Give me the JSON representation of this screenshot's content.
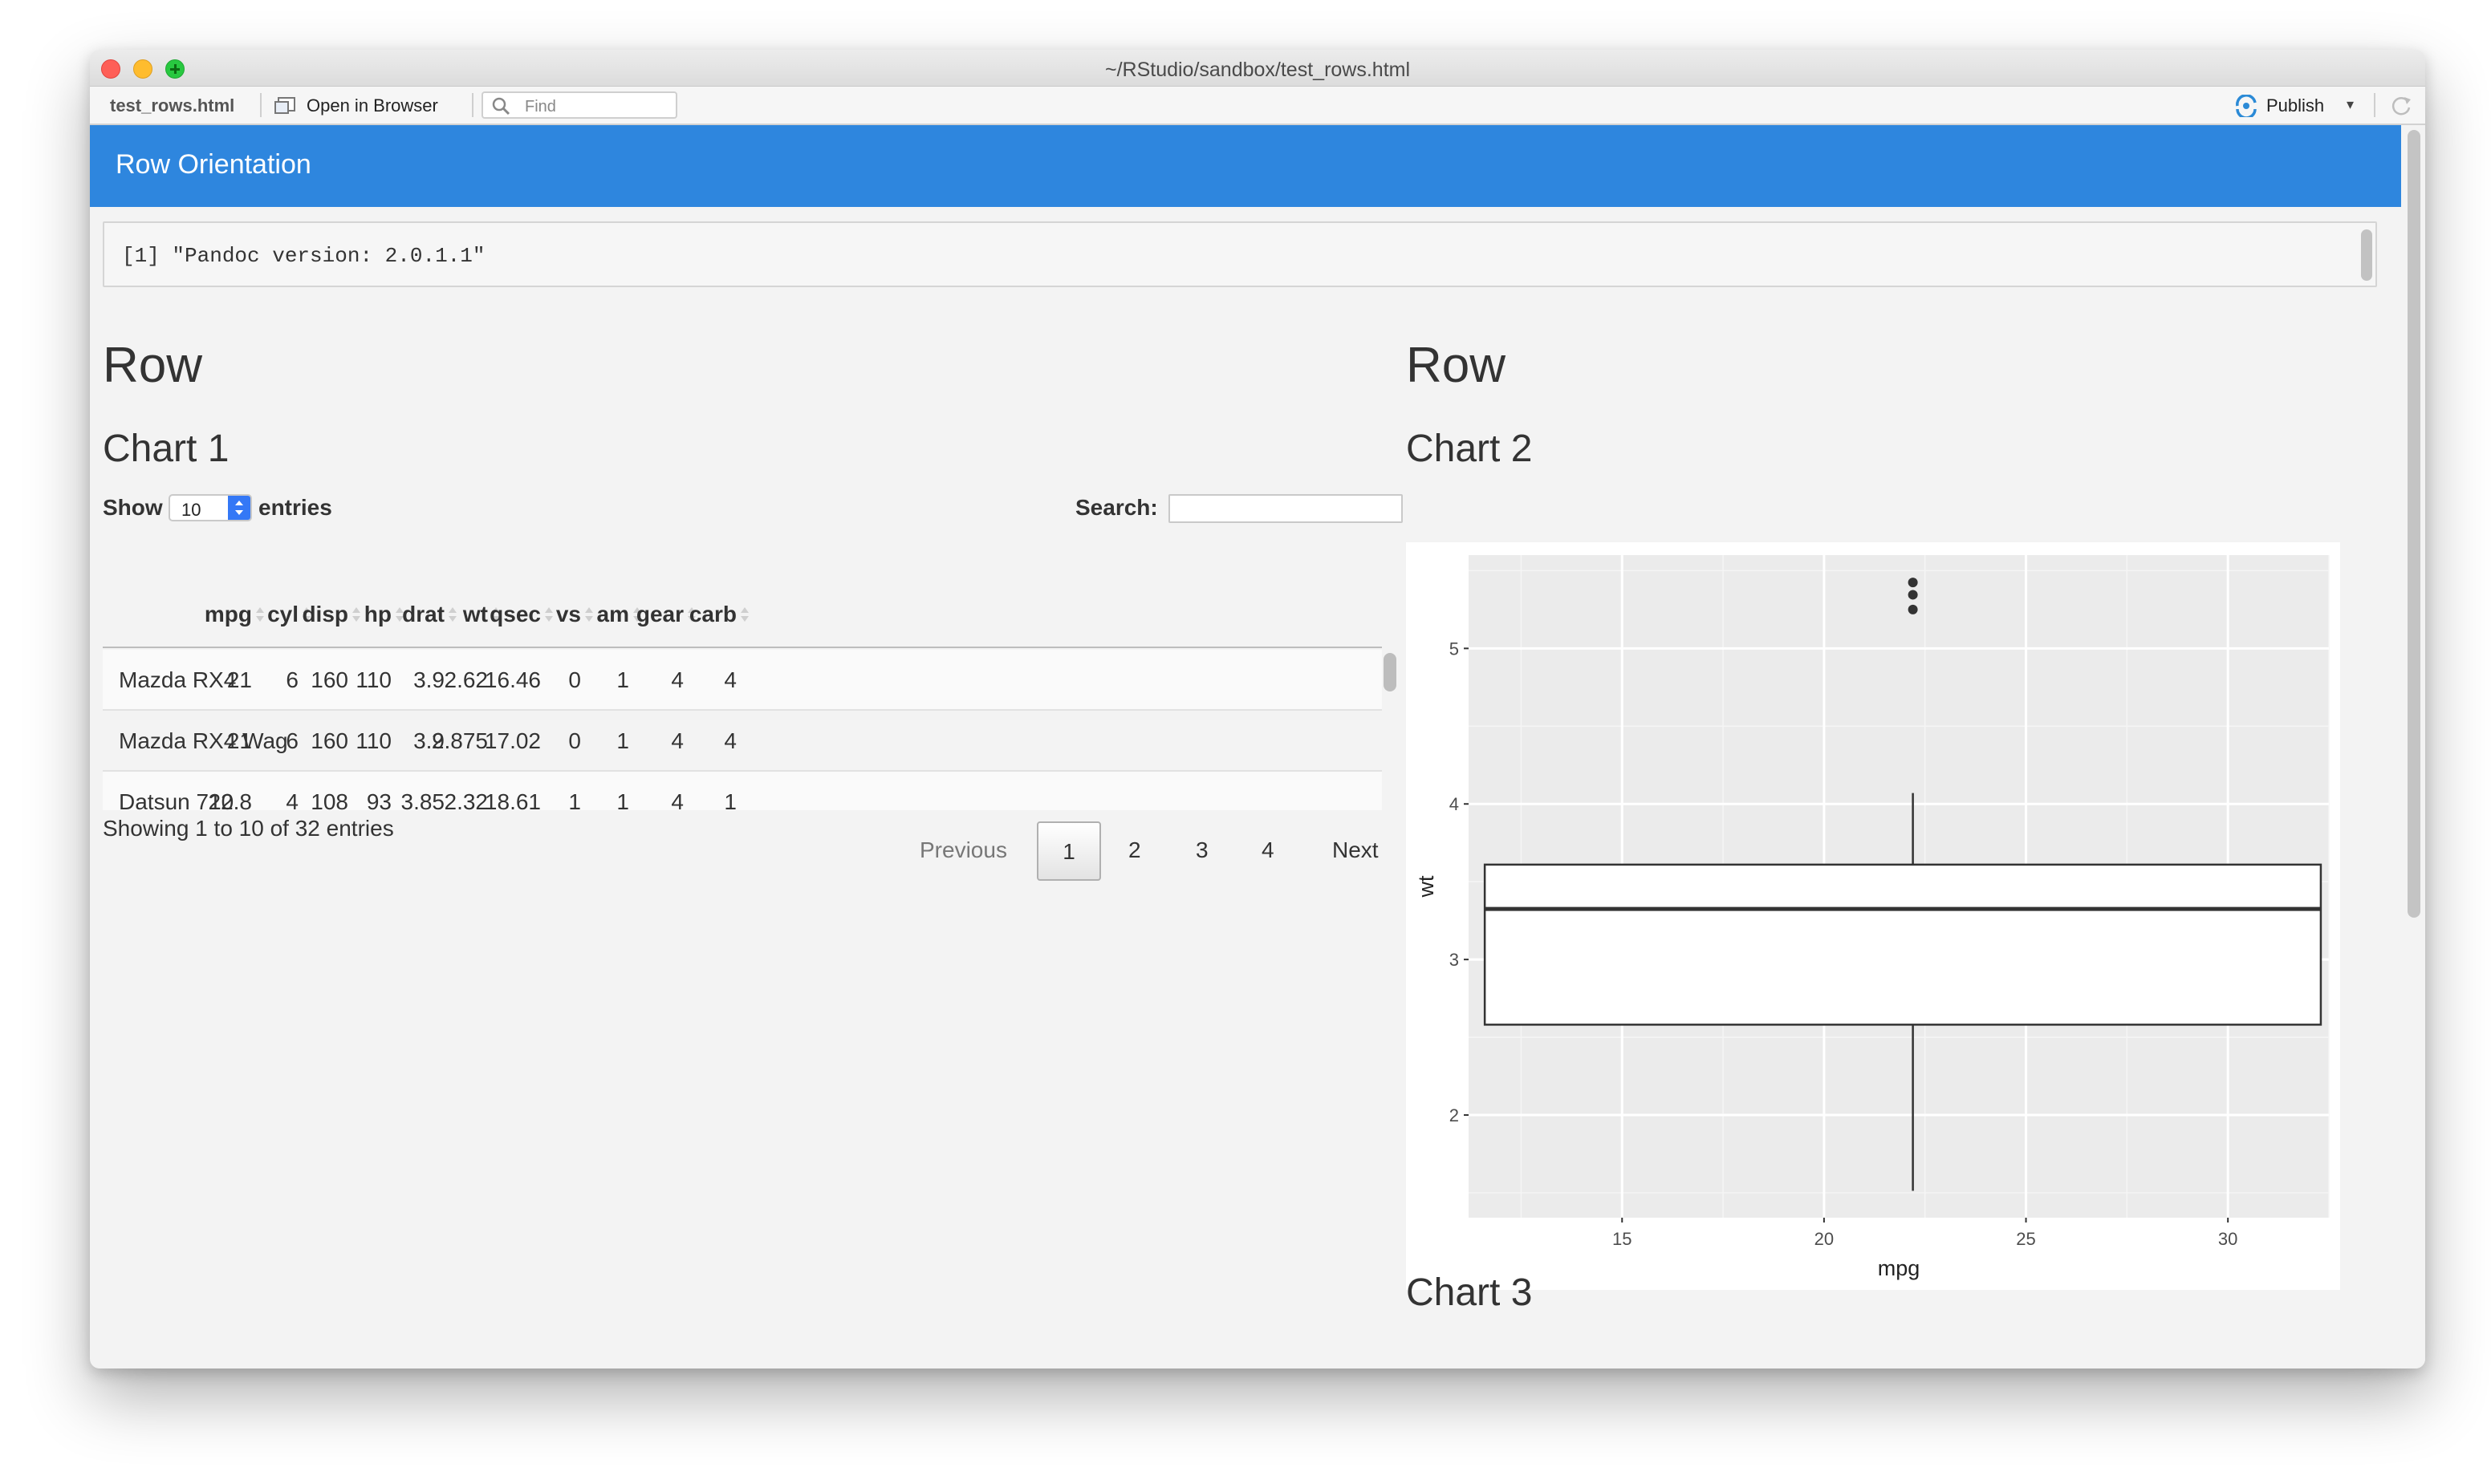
{
  "window": {
    "title": "~/RStudio/sandbox/test_rows.html"
  },
  "toolbar": {
    "file_name": "test_rows.html",
    "open_in_browser": "Open in Browser",
    "find_placeholder": "Find",
    "publish_label": "Publish",
    "icons": [
      "browser-icon",
      "search-icon",
      "publish-icon",
      "chevron-down-icon",
      "refresh-icon"
    ]
  },
  "banner": {
    "title": "Row Orientation",
    "color": "#2e86de"
  },
  "console_output": "[1] \"Pandoc version: 2.0.1.1\"",
  "left_column": {
    "row_heading": "Row",
    "chart_title": "Chart 1",
    "length_menu": {
      "show_label": "Show",
      "value": "10",
      "entries_label": "entries"
    },
    "search_label": "Search:",
    "table": {
      "columns": [
        "",
        "mpg",
        "cyl",
        "disp",
        "hp",
        "drat",
        "wt",
        "qsec",
        "vs",
        "am",
        "gear",
        "carb"
      ],
      "rows": [
        [
          "Mazda RX4",
          "21",
          "6",
          "160",
          "110",
          "3.9",
          "2.62",
          "16.46",
          "0",
          "1",
          "4",
          "4"
        ],
        [
          "Mazda RX4 Wag",
          "21",
          "6",
          "160",
          "110",
          "3.9",
          "2.875",
          "17.02",
          "0",
          "1",
          "4",
          "4"
        ],
        [
          "Datsun 710",
          "22.8",
          "4",
          "108",
          "93",
          "3.85",
          "2.32",
          "18.61",
          "1",
          "1",
          "4",
          "1"
        ]
      ]
    },
    "info": "Showing 1 to 10 of 32 entries",
    "pagination": {
      "previous": "Previous",
      "pages": [
        "1",
        "2",
        "3",
        "4"
      ],
      "current": "1",
      "next": "Next"
    }
  },
  "right_column": {
    "row_heading": "Row",
    "chart2_title": "Chart 2",
    "chart3_title": "Chart 3"
  },
  "chart_data": {
    "type": "boxplot",
    "title": "",
    "xlabel": "mpg",
    "ylabel": "wt",
    "xlim": [
      11.2,
      32.5
    ],
    "ylim": [
      1.34,
      5.6
    ],
    "x_ticks": [
      15,
      20,
      25,
      30
    ],
    "y_ticks": [
      2,
      3,
      4,
      5
    ],
    "grid": true,
    "panel_background": "#ebebeb",
    "box": {
      "x_center": 22.2,
      "x_min": 11.6,
      "x_max": 32.3,
      "lower_whisker": 1.513,
      "q1": 2.581,
      "median": 3.325,
      "q3": 3.61,
      "upper_whisker": 4.07,
      "outliers": [
        5.25,
        5.345,
        5.424
      ]
    }
  }
}
